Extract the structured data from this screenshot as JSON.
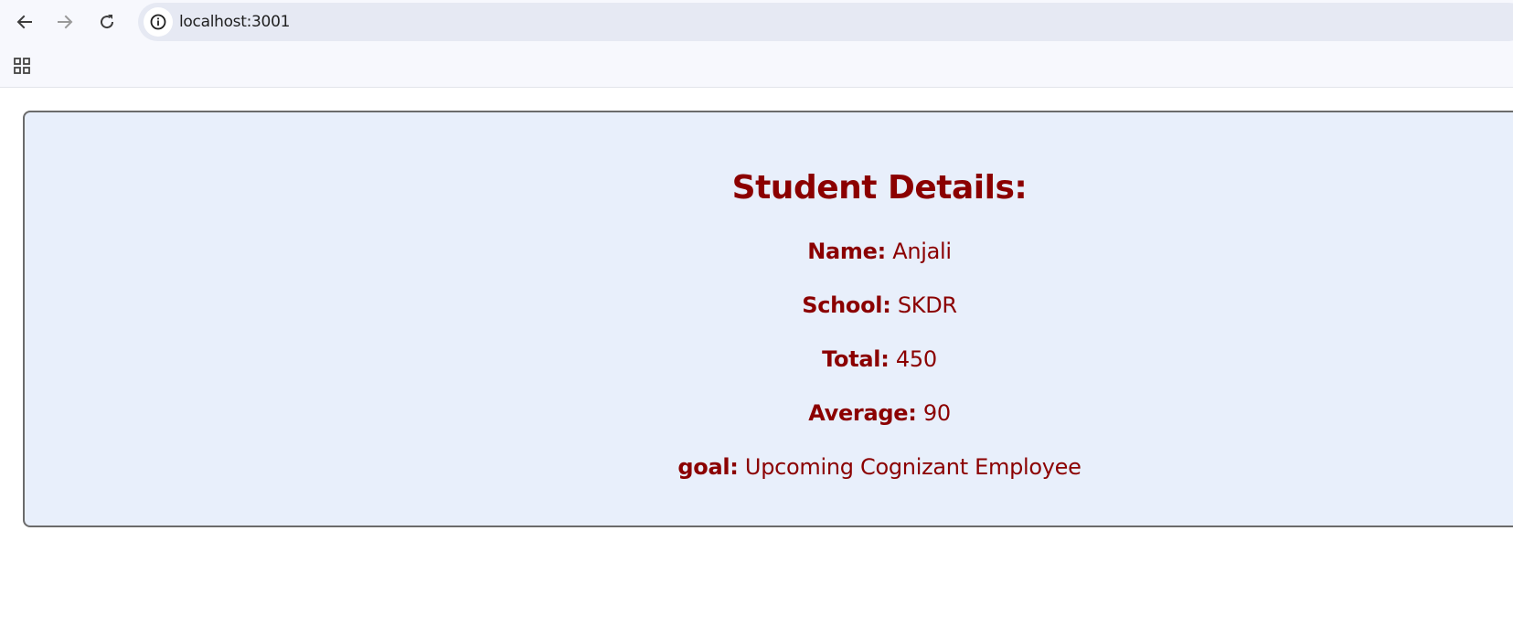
{
  "browser": {
    "url": "localhost:3001",
    "icons": {
      "back": "back-arrow-icon",
      "forward": "forward-arrow-icon",
      "reload": "reload-icon",
      "site_info": "info-icon",
      "apps": "apps-grid-icon"
    }
  },
  "student": {
    "title": "Student Details:",
    "fields": [
      {
        "label": "Name:",
        "value": "Anjali"
      },
      {
        "label": "School:",
        "value": "SKDR"
      },
      {
        "label": "Total:",
        "value": "450"
      },
      {
        "label": "Average:",
        "value": "90"
      },
      {
        "label": "goal:",
        "value": "Upcoming Cognizant Employee"
      }
    ]
  },
  "colors": {
    "text_accent": "#8b0000",
    "card_background": "#e8effb",
    "card_border": "#6b6b6b",
    "toolbar_background": "#f7f8fd",
    "omnibox_background": "#e6e9f3"
  }
}
